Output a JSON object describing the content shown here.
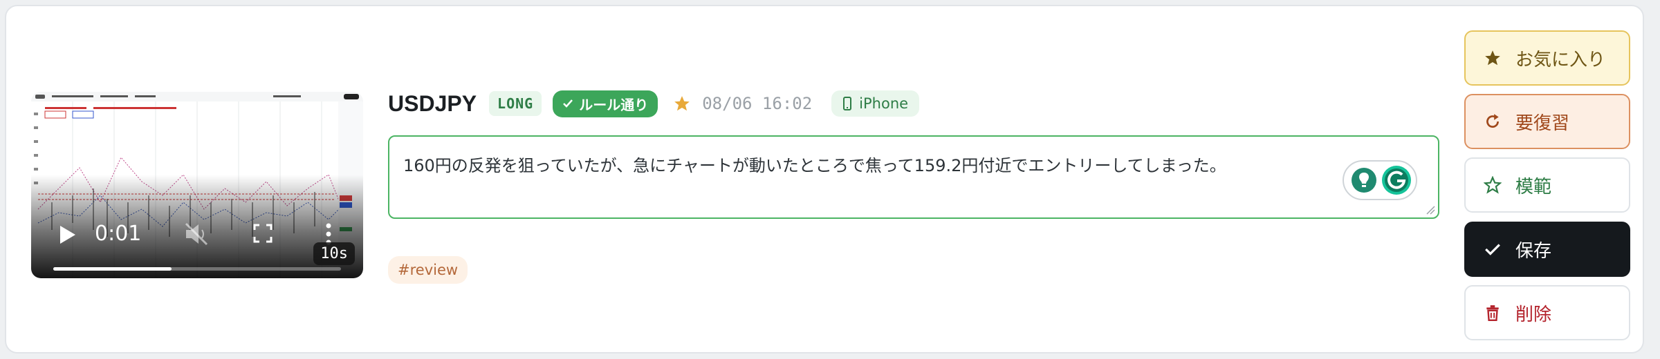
{
  "video": {
    "current_time": "0:01",
    "duration_badge": "10s",
    "progress_fraction": 0.41
  },
  "trade": {
    "pair": "USDJPY",
    "direction": "LONG",
    "rule_badge": "ルール通り",
    "datetime": "08/06 16:02",
    "device": "iPhone"
  },
  "note": {
    "text": "160円の反発を狙っていたが、急にチャートが動いたところで焦って159.2円付近でエントリーしてしまった。"
  },
  "tags": [
    "#review"
  ],
  "actions": {
    "favorite": "お気に入り",
    "needs_review": "要復習",
    "model": "模範",
    "save": "保存",
    "delete": "削除"
  },
  "colors": {
    "accent_green": "#3ca65a",
    "favorite_bg": "#fdf6d9",
    "review_bg": "#fdeee3",
    "save_bg": "#15191d",
    "delete_text": "#b4232c",
    "star": "#e8a93a"
  },
  "icons": {
    "rule_badge": "check-icon",
    "device": "smartphone-icon",
    "favorite": "star-filled-icon",
    "needs_review": "refresh-icon",
    "model": "star-outline-icon",
    "save": "check-icon",
    "delete": "trash-icon"
  }
}
